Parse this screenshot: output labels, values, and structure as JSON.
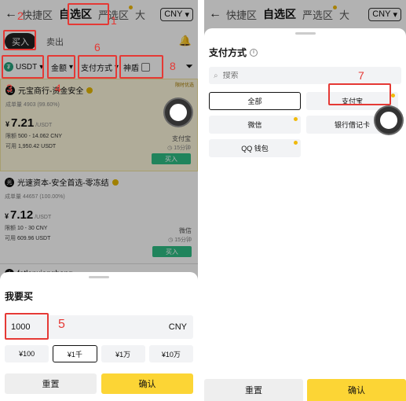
{
  "left": {
    "nav": {
      "back_icon": "←",
      "tabs": [
        "快捷区",
        "自选区",
        "严选区",
        "大"
      ],
      "currency": "CNY"
    },
    "trade_tabs": {
      "buy": "买入",
      "sell": "卖出"
    },
    "filters": {
      "coin": "USDT",
      "amount": "金额",
      "payment": "支付方式",
      "shield": "神盾"
    },
    "ads": [
      {
        "ribbon": "限时优选",
        "merchant": "元宝商行-资金安全",
        "stats": "成单量 4903 (99.60%)",
        "price_symbol": "¥",
        "price": "7.21",
        "price_unit": "/USDT",
        "limit_label": "限额",
        "limit": "500 - 14.062 CNY",
        "avail_label": "可用",
        "avail": "1,950.42 USDT",
        "payment": "支付宝",
        "time": "15分钟",
        "button": "买入"
      },
      {
        "merchant": "光速资本-安全首选-零冻结",
        "stats": "成单量 44657 (100.00%)",
        "price_symbol": "¥",
        "price": "7.12",
        "price_unit": "/USDT",
        "limit_label": "限额",
        "limit": "10 - 30 CNY",
        "avail_label": "可用",
        "avail": "609.96 USDT",
        "payment": "微信",
        "time": "15分钟",
        "button": "买入"
      },
      {
        "merchant": "fetlanxiangheng"
      }
    ],
    "sheet": {
      "title": "我要买",
      "amount_value": "1000",
      "amount_unit": "CNY",
      "quick": [
        "¥100",
        "¥1千",
        "¥1万",
        "¥10万"
      ],
      "reset": "重置",
      "confirm": "确认"
    }
  },
  "right": {
    "nav": {
      "back_icon": "←",
      "tabs": [
        "快捷区",
        "自选区",
        "严选区",
        "大"
      ],
      "currency": "CNY"
    },
    "sheet": {
      "title": "支付方式",
      "search_placeholder": "搜索",
      "options": [
        "全部",
        "支付宝",
        "微信",
        "银行借记卡",
        "QQ 钱包"
      ],
      "reset": "重置",
      "confirm": "确认"
    }
  },
  "annotations": [
    "1",
    "2",
    "3",
    "4",
    "5",
    "6",
    "7",
    "8"
  ],
  "colors": {
    "accent_yellow": "#fcd535",
    "buy_green": "#2ebd85",
    "annotation_red": "#e53935"
  }
}
